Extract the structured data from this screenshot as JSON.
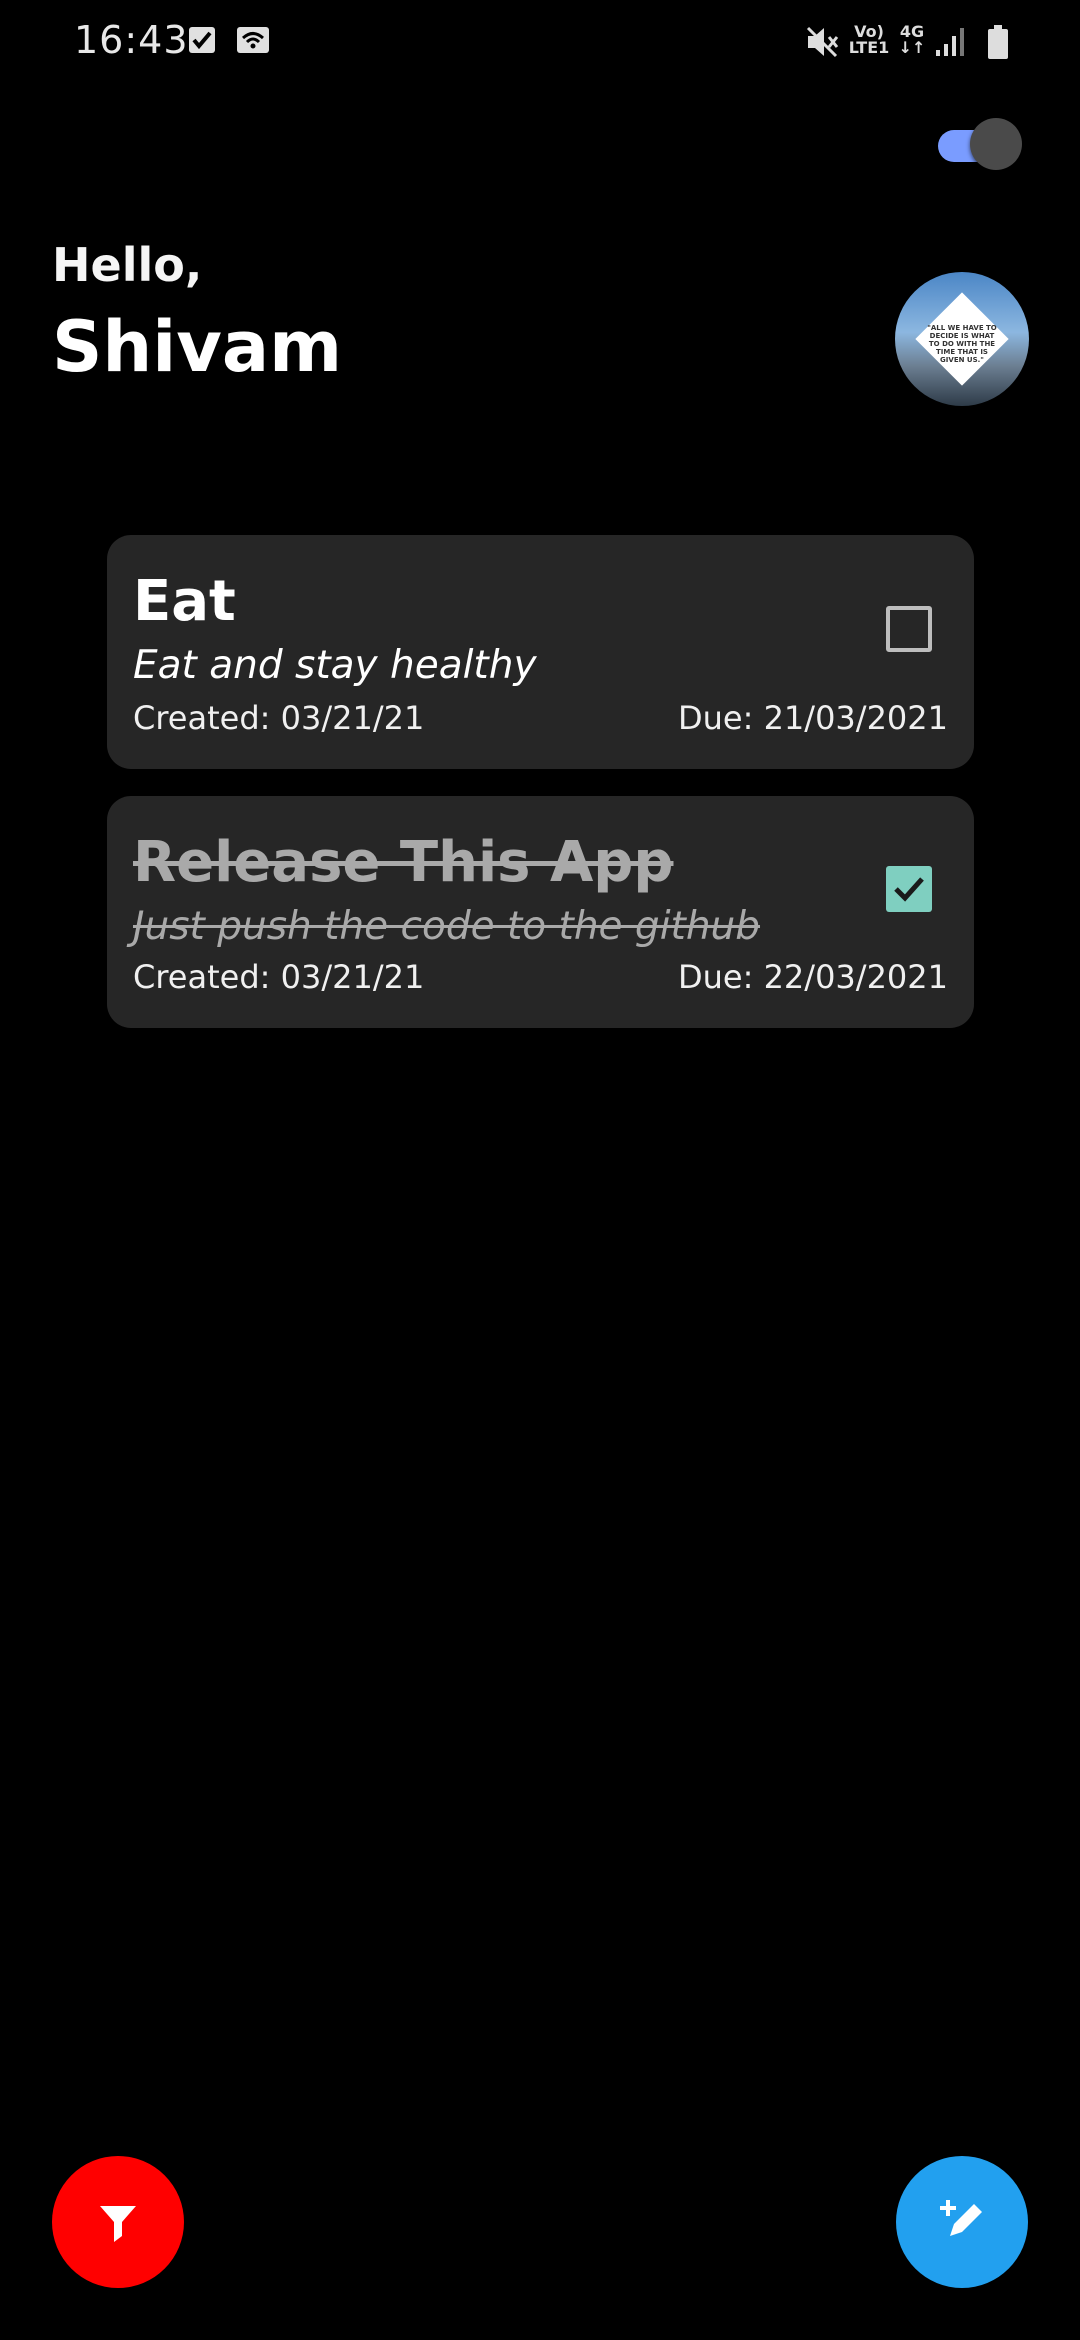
{
  "status_bar": {
    "time": "16:43",
    "volte_line1": "Vo)",
    "volte_line2": "LTE1",
    "network": "4G"
  },
  "header": {
    "greeting": "Hello,",
    "user_name": "Shivam",
    "avatar_quote": "\"ALL WE HAVE TO DECIDE IS WHAT TO DO WITH THE TIME THAT IS GIVEN US.\""
  },
  "theme_toggle": {
    "on": true,
    "accent": "#7a9cff"
  },
  "tasks": [
    {
      "title": "Eat",
      "description": "Eat and stay healthy",
      "created": "Created: 03/21/21",
      "due": "Due: 21/03/2021",
      "completed": false
    },
    {
      "title": "Release This App",
      "description": "Just push the code to the github",
      "created": "Created: 03/21/21",
      "due": "Due: 22/03/2021",
      "completed": true
    }
  ],
  "fabs": {
    "filter_icon": "filter-icon",
    "filter_color": "#ff0000",
    "add_icon": "edit-add-icon",
    "add_color": "#22a0ef"
  }
}
